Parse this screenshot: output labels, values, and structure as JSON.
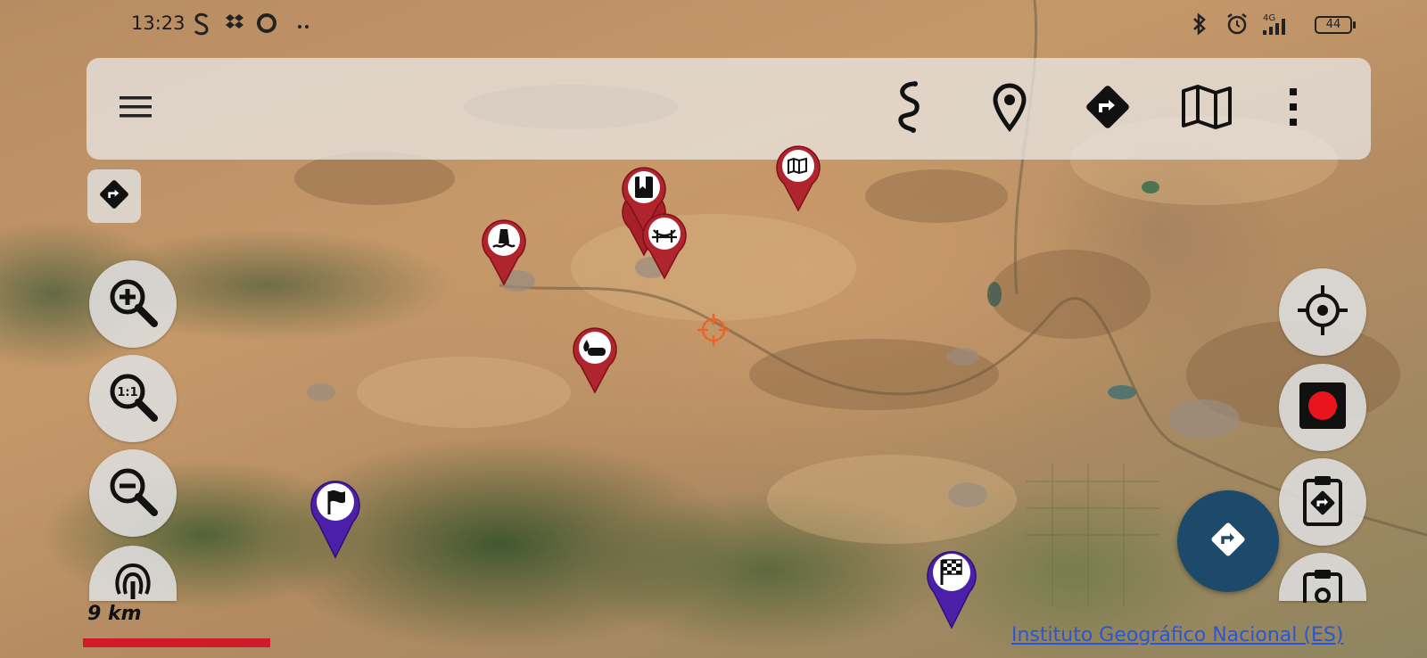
{
  "status_bar": {
    "time": "13:23",
    "left_icons": [
      "s-icon",
      "dropbox-icon",
      "circle-icon",
      "more-dots-icon"
    ],
    "right_icons": [
      "bluetooth-icon",
      "alarm-icon",
      "signal-4g-icon",
      "battery-icon"
    ],
    "network": "4G",
    "battery_level": "44"
  },
  "toolbar": {
    "menu_icon": "hamburger-menu-icon",
    "actions": [
      "tracks-icon",
      "waypoint-icon",
      "route-icon",
      "map-icon",
      "overflow-menu-icon"
    ]
  },
  "left_controls": [
    "zoom-in-icon",
    "zoom-one-to-one-icon",
    "zoom-out-icon",
    "touch-gesture-icon"
  ],
  "right_controls": [
    "crosshair-icon",
    "record-icon",
    "clipboard-route-icon",
    "clipboard-icon"
  ],
  "fab_icon": "navigate-route-icon",
  "markers": {
    "pois": [
      "map-marker",
      "book-marker",
      "bridge-marker",
      "factory-marker",
      "fire-marker"
    ],
    "start_flag": "flag-icon",
    "finish_flag": "checkered-flag-icon"
  },
  "scale": {
    "label": "9 km"
  },
  "attribution": "Instituto Geográfico Nacional (ES)",
  "colors": {
    "accent_red": "#b0242e",
    "fab_blue": "#1d4a6b",
    "flag_purple": "#4b1fa8",
    "scale_red": "#d11a2a",
    "link_blue": "#2a56d6"
  }
}
